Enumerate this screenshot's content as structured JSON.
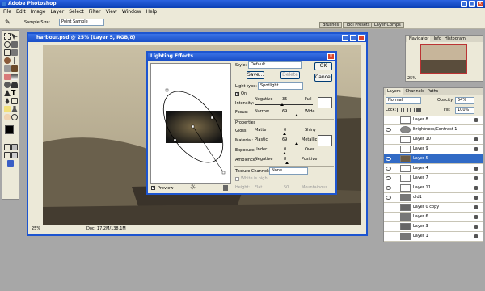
{
  "app": {
    "title": "Adobe Photoshop"
  },
  "menu": [
    "File",
    "Edit",
    "Image",
    "Layer",
    "Select",
    "Filter",
    "View",
    "Window",
    "Help"
  ],
  "options": {
    "sample_size_label": "Sample Size:",
    "sample_size_value": "Point Sample"
  },
  "palette_tabs": [
    "Brushes",
    "Tool Presets",
    "Layer Comps"
  ],
  "document": {
    "title": "harbour.psd @ 25% (Layer 5, RGB/8)",
    "zoom": "25%",
    "doc_info": "Doc: 17.2M/138.1M"
  },
  "dialog": {
    "title": "Lighting Effects",
    "style_label": "Style:",
    "style_value": "Default",
    "save": "Save...",
    "delete": "Delete",
    "ok": "OK",
    "cancel": "Cancel",
    "light_type_label": "Light type:",
    "light_type_value": "Spotlight",
    "on_label": "On",
    "intensity": {
      "label": "Intensity:",
      "min": "Negative",
      "value": "35",
      "max": "Full"
    },
    "focus": {
      "label": "Focus:",
      "min": "Narrow",
      "value": "69",
      "max": "Wide"
    },
    "properties_label": "Properties",
    "gloss": {
      "label": "Gloss:",
      "min": "Matte",
      "value": "0",
      "max": "Shiny"
    },
    "material": {
      "label": "Material:",
      "min": "Plastic",
      "value": "69",
      "max": "Metallic"
    },
    "exposure": {
      "label": "Exposure:",
      "min": "Under",
      "value": "0",
      "max": "Over"
    },
    "ambience": {
      "label": "Ambience:",
      "min": "Negative",
      "value": "8",
      "max": "Positive"
    },
    "texture_label": "Texture Channel:",
    "texture_value": "None",
    "white_high_label": "White is high",
    "height": {
      "label": "Height:",
      "min": "Flat",
      "value": "50",
      "max": "Mountainous"
    },
    "preview_label": "Preview"
  },
  "navigator": {
    "tabs": [
      "Navigator",
      "Info",
      "Histogram"
    ],
    "zoom": "25%"
  },
  "layers_panel": {
    "tabs": [
      "Layers",
      "Channels",
      "Paths"
    ],
    "blend_mode": "Normal",
    "opacity_label": "Opacity:",
    "opacity_value": "54%",
    "lock_label": "Lock:",
    "fill_label": "Fill:",
    "fill_value": "100%",
    "layers": [
      {
        "name": "Layer 8"
      },
      {
        "name": "Brightness/Contrast 1"
      },
      {
        "name": "Layer 10"
      },
      {
        "name": "Layer 9"
      },
      {
        "name": "Layer 5"
      },
      {
        "name": "Layer 4"
      },
      {
        "name": "Layer 7"
      },
      {
        "name": "Layer 11"
      },
      {
        "name": "old1"
      },
      {
        "name": "Layer 0 copy"
      },
      {
        "name": "Layer 6"
      },
      {
        "name": "Layer 3"
      },
      {
        "name": "Layer 1"
      }
    ]
  },
  "colors": {
    "accent": "#1d55d0",
    "selection": "#316ac5",
    "chrome": "#ece9d8"
  }
}
